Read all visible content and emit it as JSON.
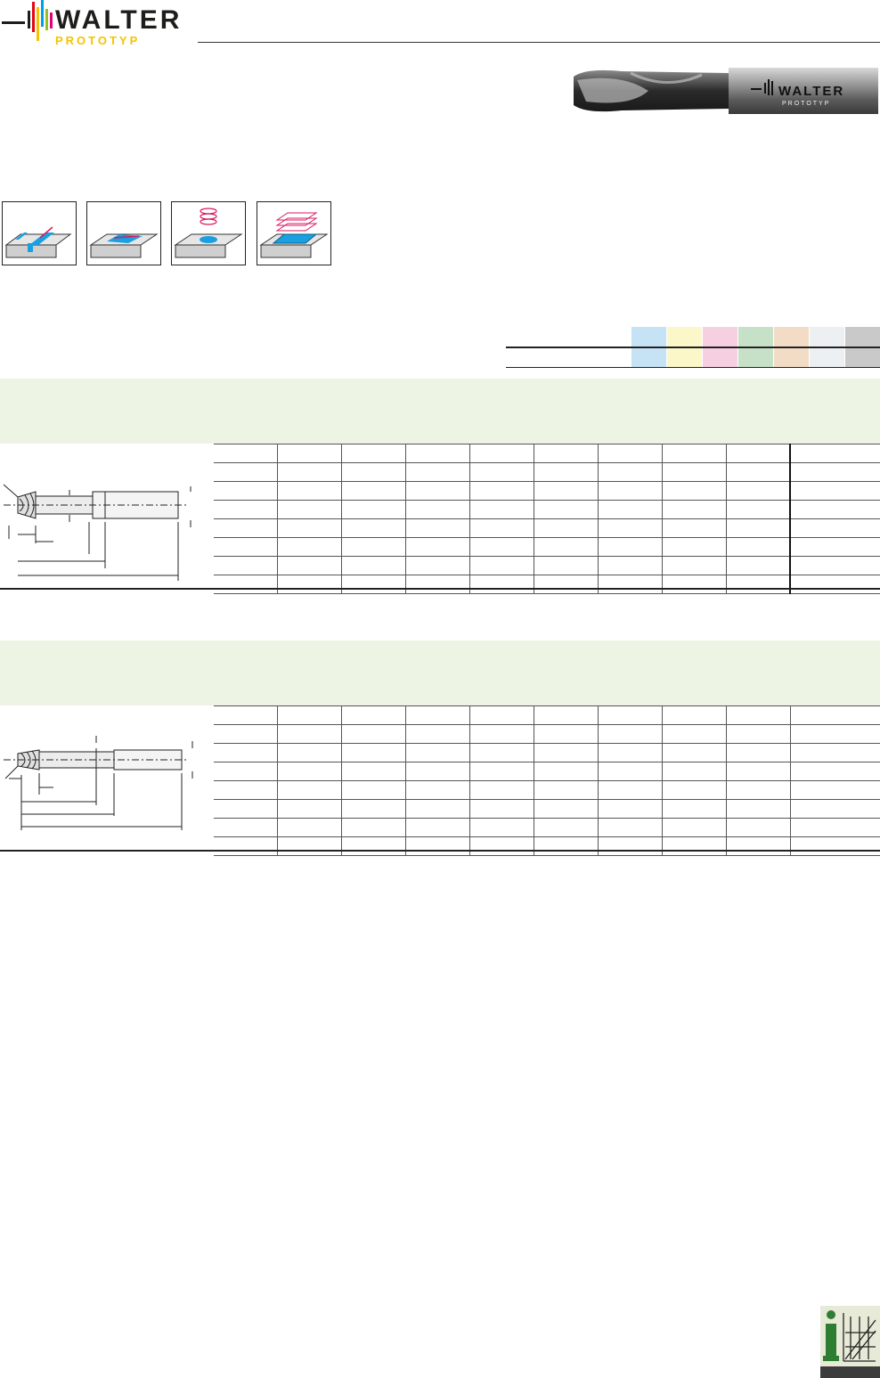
{
  "brand": {
    "name": "WALTER",
    "sub": "PROTOTYP",
    "colors": [
      "#1d1d1b",
      "#e30613",
      "#009fe3",
      "#f2c500",
      "#e5007e",
      "#95c11f"
    ]
  },
  "tool_image": {
    "logo_text": "WALTER",
    "logo_sub": "PROTOTYP"
  },
  "applications": [
    {
      "name": "slot-milling-icon"
    },
    {
      "name": "ramping-icon"
    },
    {
      "name": "helical-interpolation-icon"
    },
    {
      "name": "pocket-milling-icon"
    }
  ],
  "material_groups": {
    "colors": [
      "#c6e2f5",
      "#fbf7c8",
      "#f6cfe1",
      "#c6e1c7",
      "#f2dcc6",
      "#edf0f2",
      "#c9c9c9"
    ]
  },
  "sections": [
    {
      "name": "section-1",
      "rows": 8,
      "cols": 10
    },
    {
      "name": "section-2",
      "rows": 8,
      "cols": 10
    }
  ]
}
